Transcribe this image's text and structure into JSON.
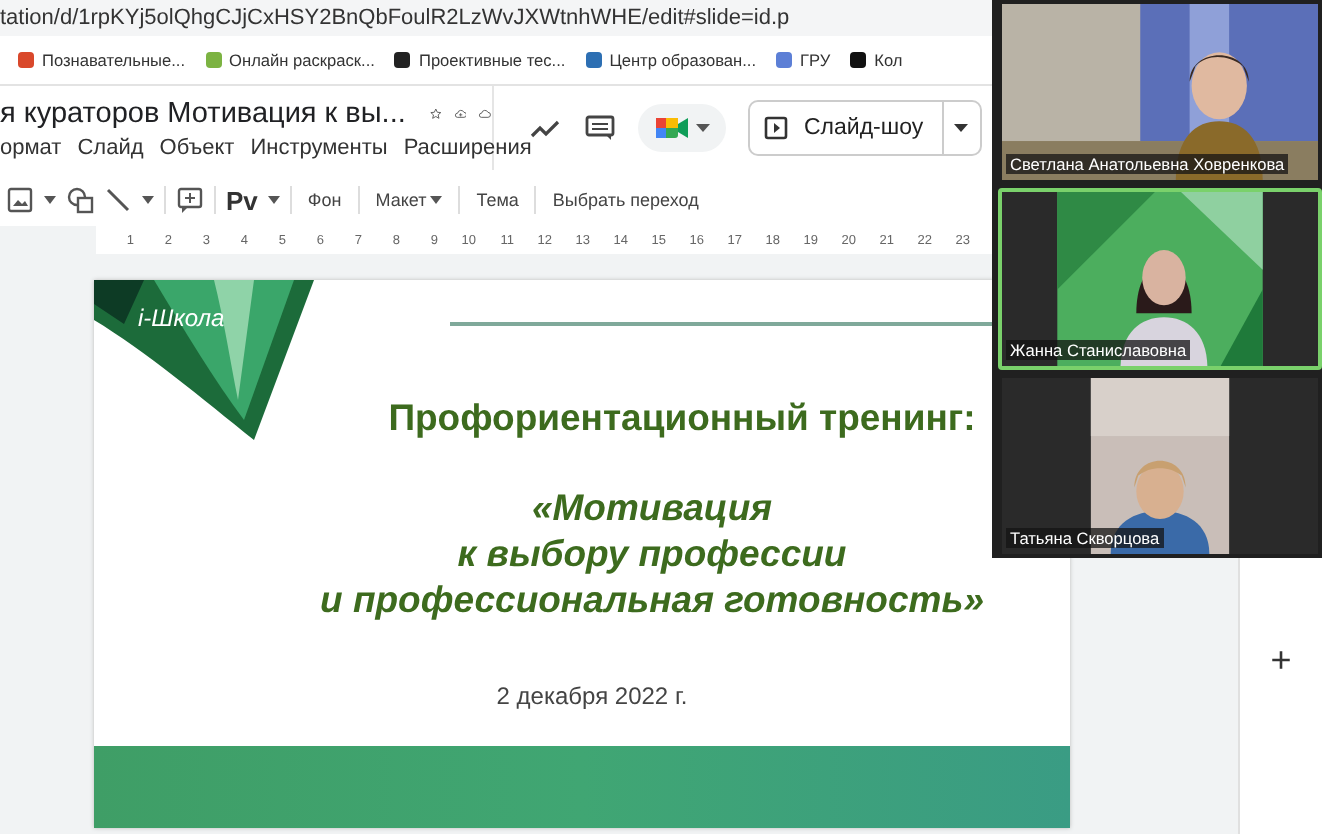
{
  "browser": {
    "url": "tation/d/1rpKYj5olQhgCJjCxHSY2BnQbFoulR2LzWvJXWtnhWHE/edit#slide=id.p",
    "bookmarks": [
      {
        "label": "Познавательные...",
        "color": "#d9482b"
      },
      {
        "label": "Онлайн раскраск...",
        "color": "#7cb342"
      },
      {
        "label": "Проективные тес...",
        "color": "#222222"
      },
      {
        "label": "Центр образован...",
        "color": "#2d6fb3"
      },
      {
        "label": "ГРУ",
        "color": "#5c7fd6"
      },
      {
        "label": "Кол",
        "color": "#111111"
      }
    ]
  },
  "document": {
    "title": "я кураторов Мотивация к вы...",
    "menu": [
      "ормат",
      "Слайд",
      "Объект",
      "Инструменты",
      "Расширения"
    ],
    "slideshow": "Слайд-шоу"
  },
  "toolbar": {
    "text_tool": "Pv",
    "items": [
      {
        "label": "Фон",
        "dropdown": false
      },
      {
        "label": "Макет",
        "dropdown": true
      },
      {
        "label": "Тема",
        "dropdown": false
      },
      {
        "label": "Выбрать переход",
        "dropdown": false
      }
    ]
  },
  "ruler": [
    "1",
    "2",
    "3",
    "4",
    "5",
    "6",
    "7",
    "8",
    "9",
    "10",
    "11",
    "12",
    "13",
    "14",
    "15",
    "16",
    "17",
    "18",
    "19",
    "20",
    "21",
    "22",
    "23"
  ],
  "slide": {
    "logo": "i-Школа",
    "title": "Профориентационный тренинг:",
    "subtitle": [
      "«Мотивация",
      "к выбору профессии",
      "и профессиональная готовность»"
    ],
    "date": "2 декабря 2022 г."
  },
  "side_panel": {
    "add": "+"
  },
  "participants": [
    {
      "name": "Светлана Анатольевна Ховренкова",
      "speaking": false
    },
    {
      "name": "Жанна Станиславовна",
      "speaking": true
    },
    {
      "name": "Татьяна Скворцова",
      "speaking": false
    }
  ]
}
